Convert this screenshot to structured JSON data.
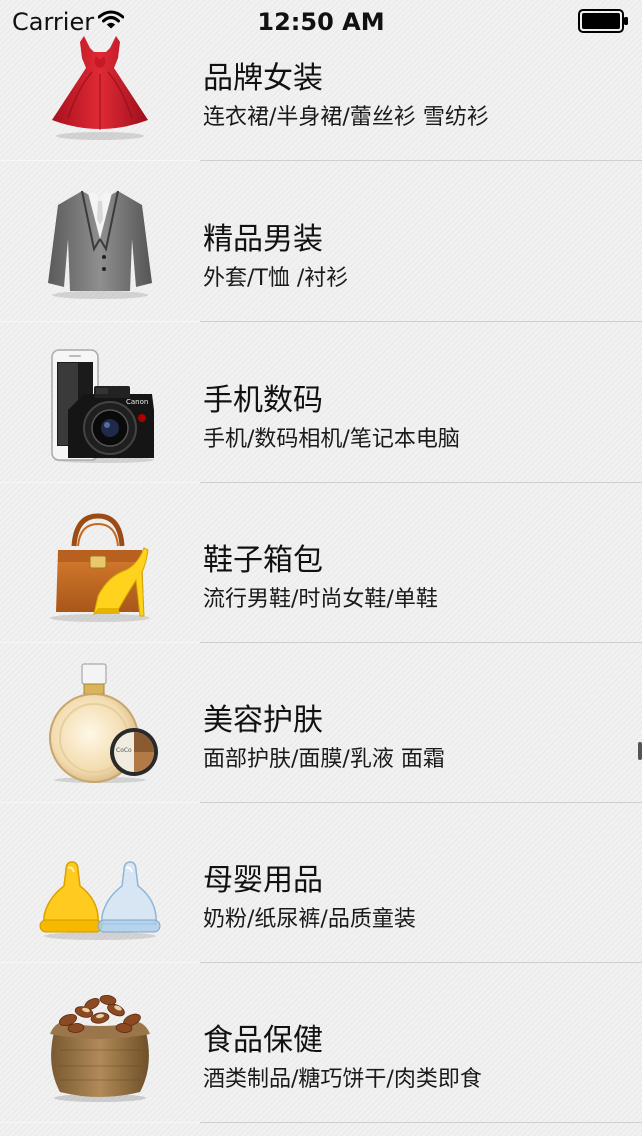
{
  "status_bar": {
    "carrier": "Carrier",
    "time": "12:50 AM",
    "wifi_icon": "wifi-icon",
    "battery_icon": "battery-icon"
  },
  "categories": [
    {
      "title": "品牌女装",
      "subtitle": "连衣裙/半身裙/蕾丝衫 雪纺衫",
      "icon": "red-dress-icon"
    },
    {
      "title": "精品男装",
      "subtitle": "外套/T恤 /衬衫",
      "icon": "mens-jacket-icon"
    },
    {
      "title": "手机数码",
      "subtitle": "手机/数码相机/笔记本电脑",
      "icon": "phone-camera-icon"
    },
    {
      "title": "鞋子箱包",
      "subtitle": "流行男鞋/时尚女鞋/单鞋",
      "icon": "handbag-heel-icon"
    },
    {
      "title": "美容护肤",
      "subtitle": "面部护肤/面膜/乳液 面霜",
      "icon": "perfume-compact-icon"
    },
    {
      "title": "母婴用品",
      "subtitle": "奶粉/纸尿裤/品质童装",
      "icon": "baby-bottle-nipples-icon"
    },
    {
      "title": "食品保健",
      "subtitle": "酒类制品/糖巧饼干/肉类即食",
      "icon": "nut-sack-icon"
    }
  ]
}
